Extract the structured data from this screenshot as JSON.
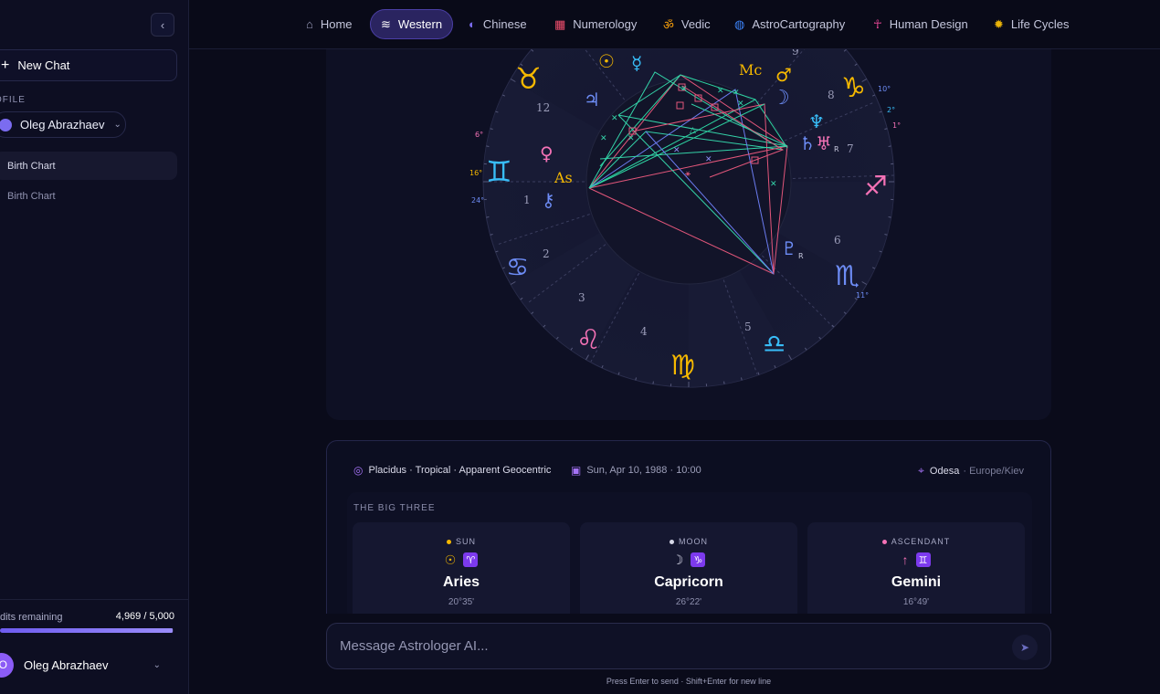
{
  "sidebar": {
    "new_chat": "New Chat",
    "profile_label": "OFILE",
    "profile_name": "Oleg Abrazhaev",
    "items": [
      {
        "label": "Birth Chart"
      },
      {
        "label": "Birth Chart"
      }
    ],
    "credits_label": "dits remaining",
    "credits_value": "4,969 / 5,000",
    "credits_fraction": 0.994,
    "user_initial": "O",
    "user_name": "Oleg Abrazhaev"
  },
  "nav": [
    {
      "label": "Home",
      "icon": "⌂",
      "icon_name": "home-icon",
      "color": "#9a9cbb"
    },
    {
      "label": "Western",
      "icon": "≋",
      "icon_name": "aquarius-waves-icon",
      "color": "#ffffff"
    },
    {
      "label": "Chinese",
      "icon": "◐",
      "icon_name": "yin-yang-icon",
      "color": "#7c6df0"
    },
    {
      "label": "Numerology",
      "icon": "▦",
      "icon_name": "grid-icon",
      "color": "#ef4e6d"
    },
    {
      "label": "Vedic",
      "icon": "ॐ",
      "icon_name": "om-icon",
      "color": "#f59e0b"
    },
    {
      "label": "AstroCartography",
      "icon": "◍",
      "icon_name": "globe-icon",
      "color": "#3b82f6"
    },
    {
      "label": "Human Design",
      "icon": "☥",
      "icon_name": "figure-icon",
      "color": "#ec4899"
    },
    {
      "label": "Life Cycles",
      "icon": "✹",
      "icon_name": "sun-cycle-icon",
      "color": "#eab308"
    }
  ],
  "chart": {
    "houses": [
      "1",
      "2",
      "3",
      "4",
      "5",
      "6",
      "7",
      "8",
      "9",
      "12"
    ],
    "signs": {
      "taurus": "♉",
      "gemini": "♊",
      "cancer": "♋",
      "leo": "♌",
      "virgo": "♍",
      "libra": "♎",
      "scorpio": "♏",
      "sagittarius": "♐",
      "capricorn": "♑"
    },
    "planets": {
      "sun": "☉",
      "moon": "☽",
      "mercury": "☿",
      "venus": "♀",
      "mars": "♂",
      "jupiter": "♃",
      "saturn": "♄",
      "uranus": "♅",
      "neptune": "♆",
      "pluto": "♇",
      "chiron": "⚷"
    },
    "angles": {
      "asc": "As",
      "mc": "Mc"
    },
    "retro": "R",
    "degrees": [
      "6°",
      "16°",
      "24°",
      "10°",
      "2°",
      "1°",
      "11°"
    ]
  },
  "summary": {
    "system": "Placidus · Tropical · Apparent Geocentric",
    "date": "Sun, Apr 10, 1988 · 10:00",
    "city": "Odesa",
    "timezone": "· Europe/Kiev",
    "big_three_title": "THE BIG THREE",
    "cards": [
      {
        "label": "SUN",
        "planet": "☉",
        "sign_glyph": "♈",
        "sign": "Aries",
        "degree": "20°35'",
        "dot": "#f5b800",
        "planet_color": "#f5b800"
      },
      {
        "label": "MOON",
        "planet": "☽",
        "sign_glyph": "♑",
        "sign": "Capricorn",
        "degree": "26°22'",
        "dot": "#d7d8e8",
        "planet_color": "#d7d8e8"
      },
      {
        "label": "ASCENDANT",
        "planet": "↑",
        "sign_glyph": "♊",
        "sign": "Gemini",
        "degree": "16°49'",
        "dot": "#f472b6",
        "planet_color": "#f472b6"
      }
    ]
  },
  "composer": {
    "placeholder": "Message Astrologer AI...",
    "hint": "Press Enter to send · Shift+Enter for new line"
  }
}
